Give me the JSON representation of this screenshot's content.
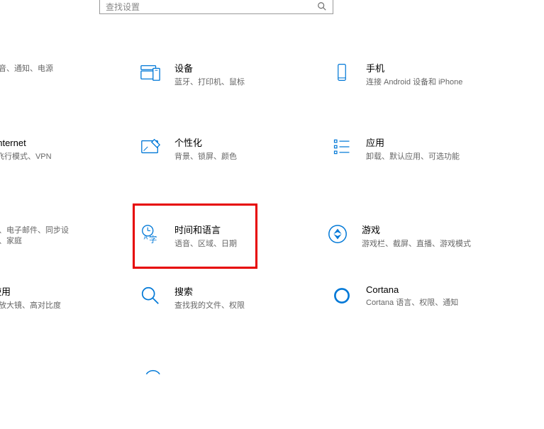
{
  "search": {
    "placeholder": "查找设置"
  },
  "colors": {
    "accent": "#0078d7",
    "highlight": "#e60000",
    "text": "#000",
    "sub": "#666"
  },
  "tiles": {
    "system": {
      "title": "",
      "desc": "、声音、通知、电源"
    },
    "devices": {
      "title": "设备",
      "desc": "蓝牙、打印机、鼠标"
    },
    "phone": {
      "title": "手机",
      "desc": "连接 Android 设备和 iPhone"
    },
    "network": {
      "title": "和 Internet",
      "desc": "N、飞行模式、VPN"
    },
    "personal": {
      "title": "个性化",
      "desc": "背景、锁屏、颜色"
    },
    "apps": {
      "title": "应用",
      "desc": "卸载、默认应用、可选功能"
    },
    "accounts": {
      "title": "",
      "desc": "帐户、电子邮件、同步设\n工作、家庭"
    },
    "timelang": {
      "title": "时间和语言",
      "desc": "语音、区域、日期"
    },
    "gaming": {
      "title": "游戏",
      "desc": "游戏栏、截屏、直播、游戏模式"
    },
    "ease": {
      "title": "讼使用",
      "desc": "人、放大镜、高对比度"
    },
    "searchc": {
      "title": "搜索",
      "desc": "查找我的文件、权限"
    },
    "cortana": {
      "title": "Cortana",
      "desc": "Cortana 语言、权限、通知"
    }
  }
}
